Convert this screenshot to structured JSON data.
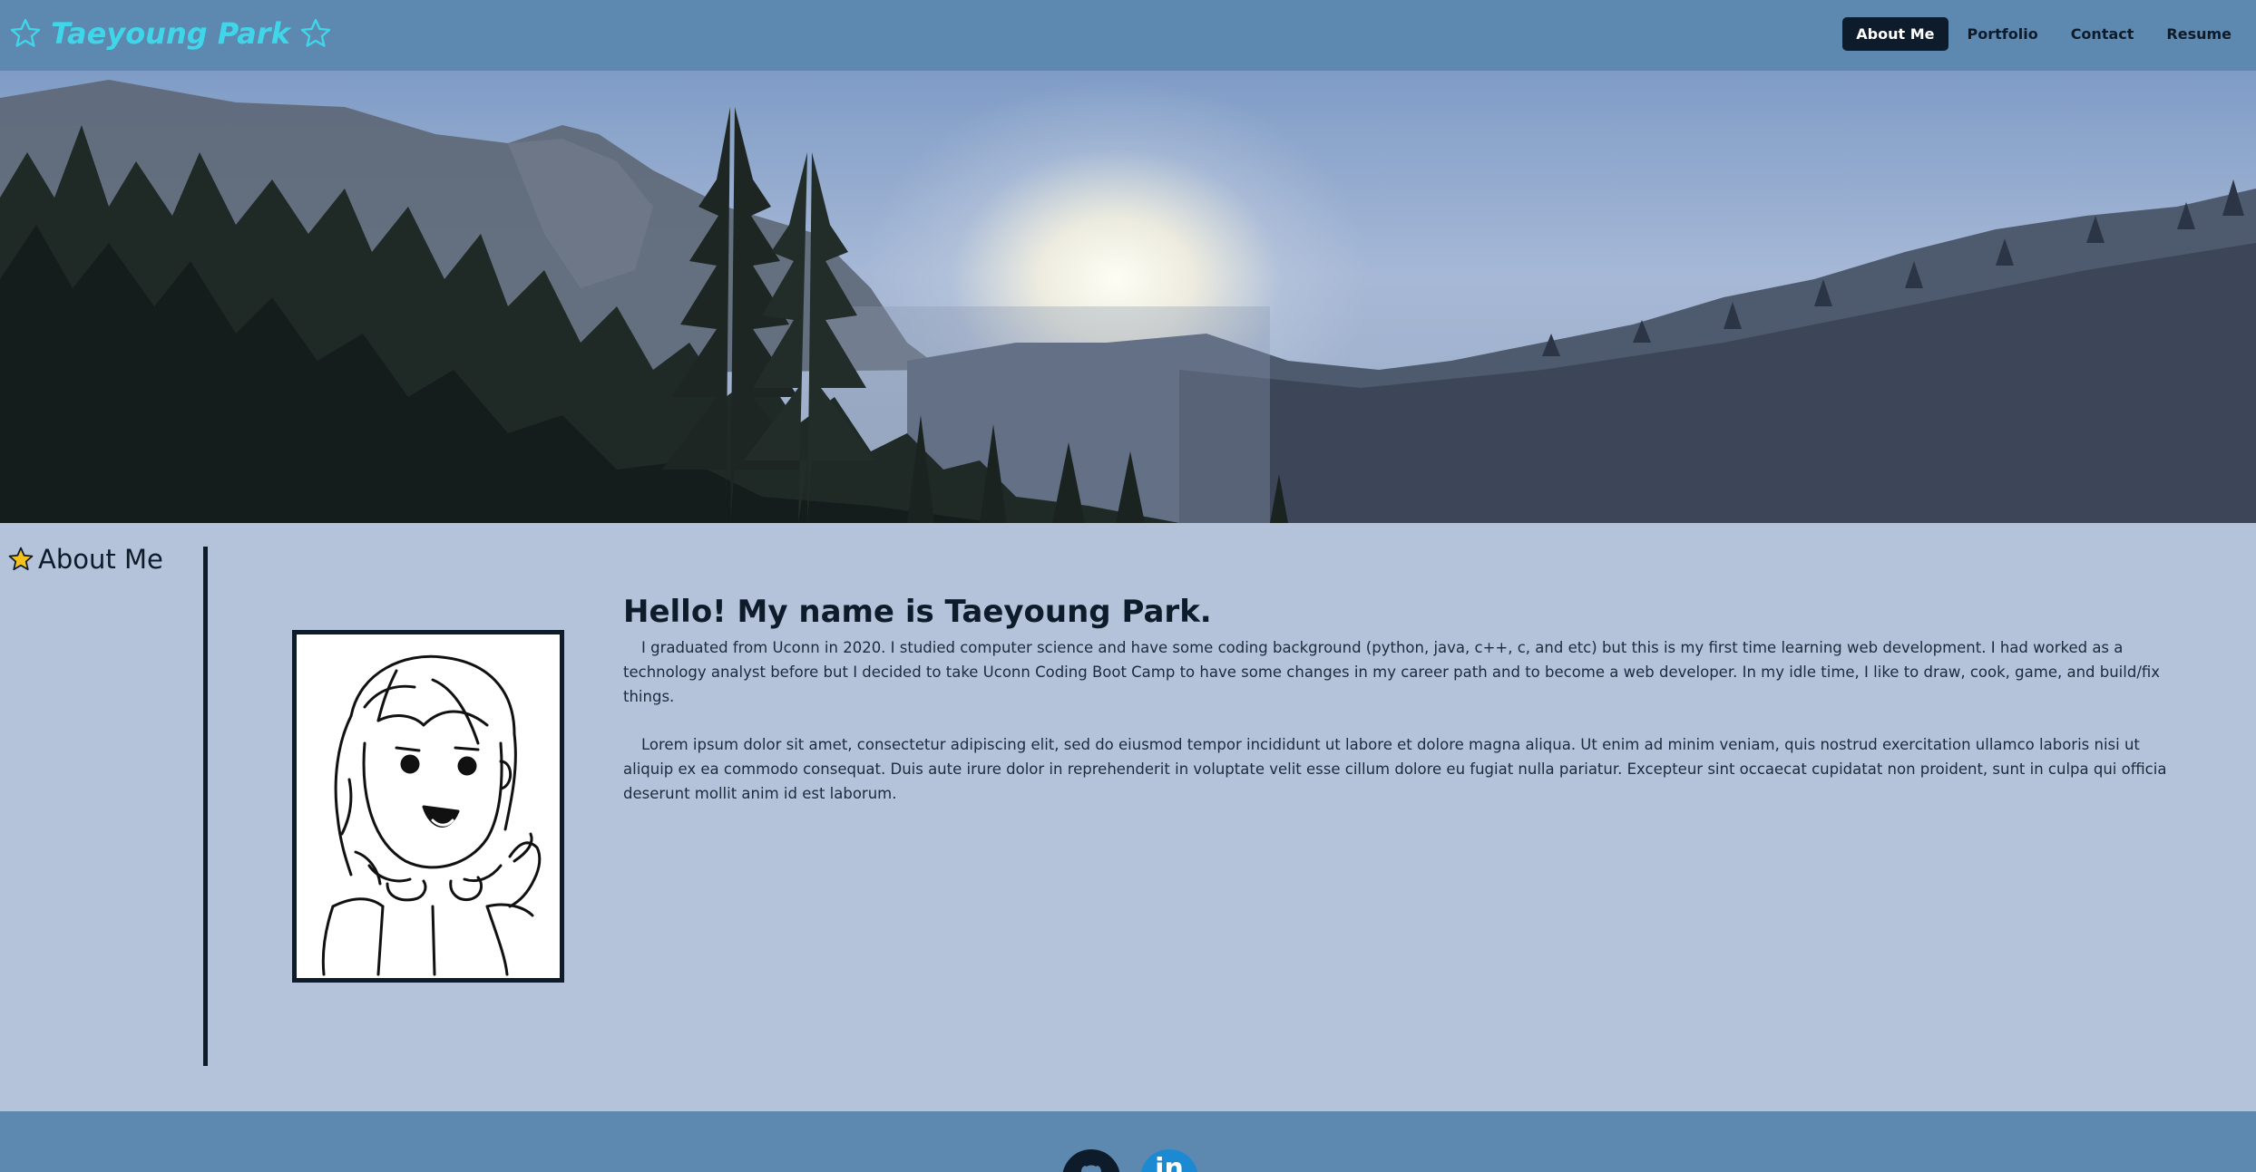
{
  "header": {
    "brand_name": "Taeyoung Park",
    "brand_color": "#3fd6ea",
    "background_color": "#5d88b0",
    "left_icon": "star-outline-icon",
    "right_icon": "star-outline-icon",
    "nav": [
      {
        "label": "About Me",
        "active": true
      },
      {
        "label": "Portfolio",
        "active": false
      },
      {
        "label": "Contact",
        "active": false
      },
      {
        "label": "Resume",
        "active": false
      }
    ]
  },
  "hero": {
    "image": "forest-mountain-sunrise-banner"
  },
  "about": {
    "section_title": "About Me",
    "section_icon": "star-filled-icon",
    "greeting": "Hello! My name is Taeyoung Park.",
    "paragraphs": [
      "I graduated from Uconn in 2020. I studied computer science and have some coding background (python, java, c++, c, and etc) but this is my first time learning web development. I had worked as a technology analyst before but I decided to take Uconn Coding Boot Camp to have some changes in my career path and to become a web developer. In my idle time, I like to draw, cook, game, and build/fix things.",
      "Lorem ipsum dolor sit amet, consectetur adipiscing elit, sed do eiusmod tempor incididunt ut labore et dolore magna aliqua. Ut enim ad minim veniam, quis nostrud exercitation ullamco laboris nisi ut aliquip ex ea commodo consequat. Duis aute irure dolor in reprehenderit in voluptate velit esse cillum dolore eu fugiat nulla pariatur. Excepteur sint occaecat cupidatat non proident, sunt in culpa qui officia deserunt mollit anim id est laborum."
    ],
    "portrait": "hand-drawn-self-portrait-waving"
  },
  "footer": {
    "background_color": "#5d88b0",
    "social": [
      {
        "name": "github-icon",
        "label": ""
      },
      {
        "name": "linkedin-icon",
        "label": "in"
      }
    ]
  },
  "colors": {
    "dark": "#0d1b2a",
    "page_bg": "#b4c3da",
    "linkedin": "#1c8ad2"
  }
}
